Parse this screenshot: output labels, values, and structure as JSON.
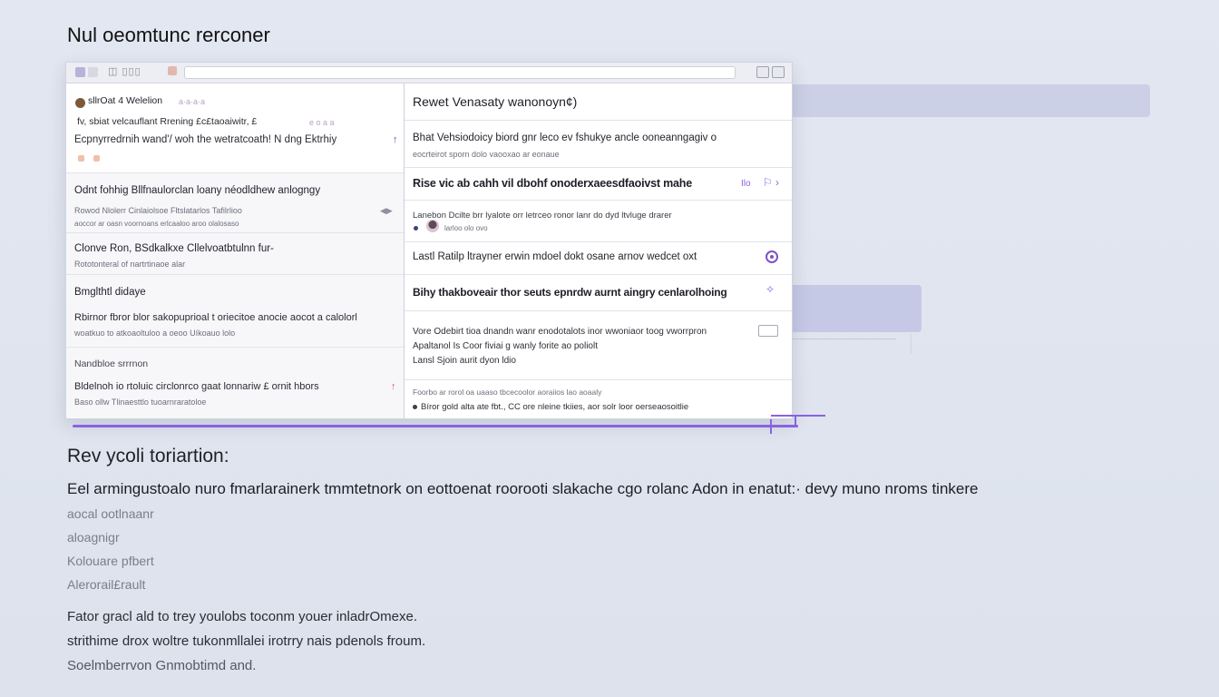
{
  "page_title": "Nul  oeomtunc rerconer",
  "window": {
    "toolbar_icons": "⬚⬚"
  },
  "left_list": [
    {
      "title": "sllrOat 4 Welelion",
      "title_side": "a·a·a·a",
      "subtitle": "fv, sbiat velcauflant Rrening £c£taoaiwitr, £",
      "subtitle_side": "e o a a",
      "body": "Ecpnyrredrnih wand'/ woh the wetratcoath! N dng Ektrhiy"
    },
    {
      "title": "Odnt fohhig Bllfnaulorclan loany néodldhew anlogngy",
      "subtitle": "Rowod Nlolerr  Cinlaiolsoe  Fltslatarlos  Tafilrlioo",
      "subtitle2": "aoccor ar oasn  voornoans  erlcaaloo  aroo olalosaso"
    },
    {
      "title": "Clonve Ron, BSdkalkxe Cllelvoatbtulnn fur-",
      "subtitle": "Rototonteral of nartrtinaoe alar"
    },
    {
      "title": "Bmglthtl didaye",
      "body": "Rbirnor fbror blor sakopuprioal t oriecitoe anocie aocot a calolorl",
      "subtitle": "woatkuo to atkoaoltuloo  a oeoo Uíkoauo lolo"
    },
    {
      "title": "Nandbloe srrrnon",
      "body": "Bldelnoh io rtoluic circlonrco gaat lonnariw £ ornit hbors",
      "subtitle": "Baso ollw  Tlinaesttlo  tuoarnraratoloe"
    }
  ],
  "right_panel": {
    "header": "Rewet  Venasaty wanonoyn¢)",
    "rows": [
      {
        "main": "Bhat Vehsiodoicy biord gnr leco ev fshukye ancle ooneanngagiv o",
        "sub": "eocrteirot sporn  dolo  vaooxao  ar  eonaue"
      },
      {
        "bold": "Rise vic ab cahh vil dbohf onoderxaeesdfaoivst mahe",
        "side": "Ilo"
      },
      {
        "main": "Lanebon Dcilte brr lyalote orr letrceo ronor lanr do dyd ltvluge drarer",
        "sub": "larloo olo ovo"
      },
      {
        "main": "Lastl Ratilp ltrayner erwin mdoel dokt osane arnov wedcet oxt"
      },
      {
        "bold": "Bihy thakboveair thor seuts epnrdw aurnt aingry cenlarolhoing"
      },
      {
        "main": "Vore Odebirt tioa dnandn  wanr enodotalots inor wwoniaor  toog vworrpron",
        "main2": "Apaltanol Is Coor fiviai ɡ wanly forite ao poliolt",
        "main3": "Lansl Sjoin aurit dyon  ldio"
      },
      {
        "sub": "Foorbo ar rorol oa  uaaso  tbcecoolor aoraiios lao aoaaly",
        "main": "Bíror gold alta ate  fbt.,  CC ore nleine tkiies, aor solr loor  oerseaosoitlie"
      }
    ]
  },
  "section_heading": "Rev ycoli toriartion:",
  "description": "Eel armingustoalo nuro fmarlarainerk tmmtetnork on eottoenat roorooti slakache cgo rolanc Adon in enatut:· devy muno nroms tinkere",
  "muted_lines": [
    "aocal ootlnaanr",
    "aloagnigr",
    "Kolouare pfbert",
    "Alerorail£rault"
  ],
  "footer_lines": [
    "Fator gracl ald to trey youlobs toconm youer inladrOmexe.",
    "strithime drox woltre tukonmllalei irotrry nais pdenols froum.",
    "Soelmberrvon Gnmobtimd and."
  ]
}
